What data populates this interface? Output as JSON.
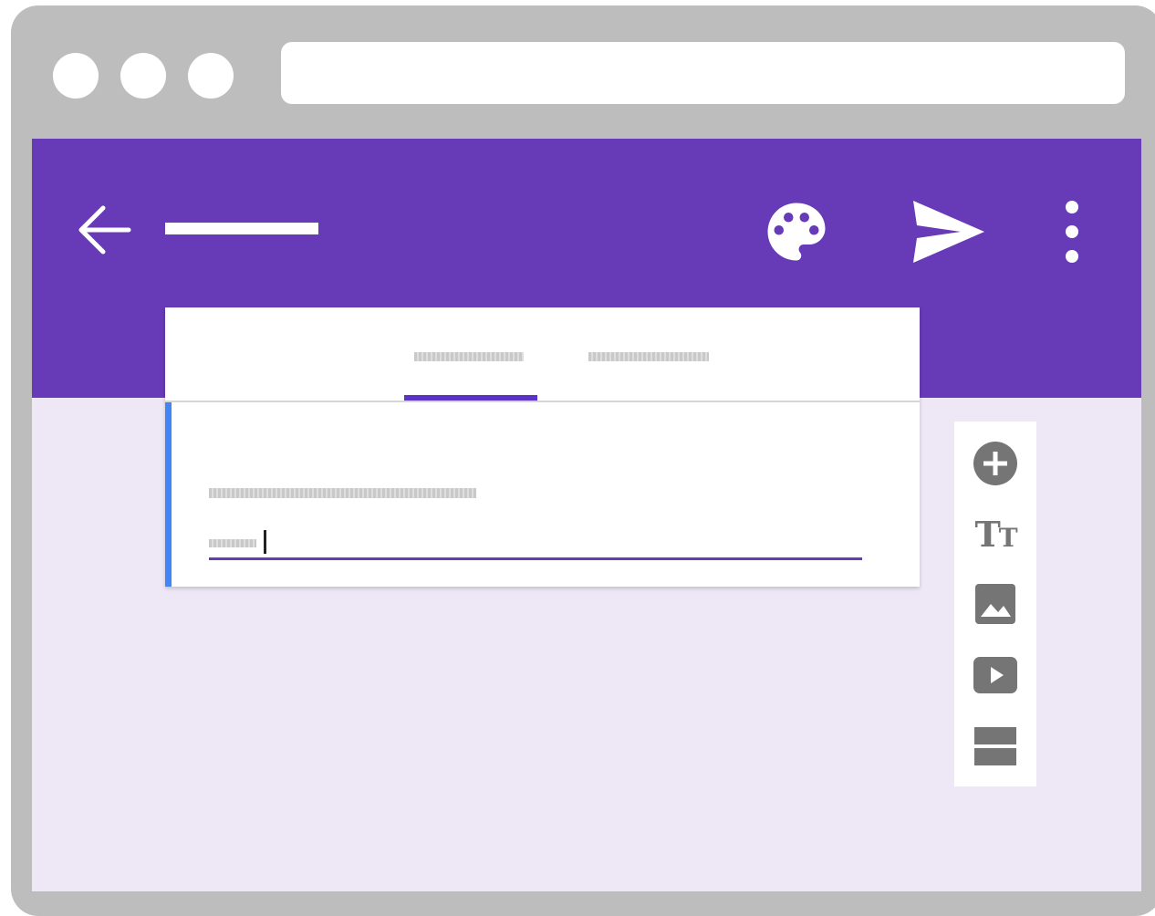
{
  "colors": {
    "browser_frame": "#bdbdbd",
    "header": "#673ab7",
    "page_background": "#ede7f6",
    "active_tab_indicator": "#5c32c7",
    "question_focus_bar": "#4285f4",
    "toolbar_icon": "#757575"
  },
  "header": {
    "back_icon": "arrow-left-icon",
    "actions": [
      "palette-icon",
      "send-icon",
      "more-vert-icon"
    ]
  },
  "form_card": {
    "tabs": [
      {
        "name": "tab-questions",
        "active": true
      },
      {
        "name": "tab-responses",
        "active": false
      }
    ]
  },
  "side_toolbar": {
    "tools": [
      {
        "icon": "add-circle-icon"
      },
      {
        "icon": "title-text-icon",
        "glyph_big": "T",
        "glyph_small": "T"
      },
      {
        "icon": "image-icon"
      },
      {
        "icon": "video-icon"
      },
      {
        "icon": "section-icon"
      }
    ]
  }
}
